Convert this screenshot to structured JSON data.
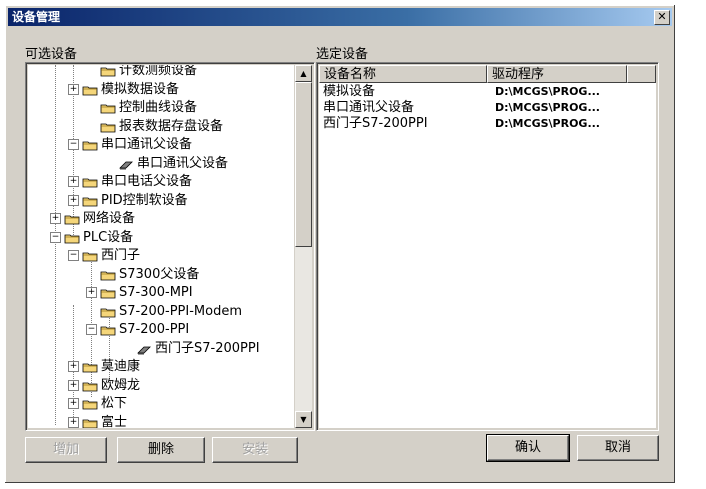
{
  "window": {
    "title": "设备管理",
    "close_glyph": "✕"
  },
  "left_group": {
    "label": "可选设备",
    "tree": [
      {
        "label": "计数测频设备",
        "expander": "",
        "kind": "folder"
      },
      {
        "label": "模拟数据设备",
        "expander": "+",
        "kind": "folder"
      },
      {
        "label": "控制曲线设备",
        "expander": "",
        "kind": "folder"
      },
      {
        "label": "报表数据存盘设备",
        "expander": "",
        "kind": "folder"
      },
      {
        "label": "串口通讯父设备",
        "expander": "−",
        "kind": "folder"
      },
      {
        "label": "串口通讯父设备",
        "expander": "",
        "kind": "device"
      },
      {
        "label": "串口电话父设备",
        "expander": "+",
        "kind": "folder"
      },
      {
        "label": "PID控制软设备",
        "expander": "+",
        "kind": "folder"
      },
      {
        "label": "网络设备",
        "expander": "+",
        "kind": "folder"
      },
      {
        "label": "PLC设备",
        "expander": "−",
        "kind": "folder"
      },
      {
        "label": "西门子",
        "expander": "−",
        "kind": "folder"
      },
      {
        "label": "S7300父设备",
        "expander": "",
        "kind": "folder"
      },
      {
        "label": "S7-300-MPI",
        "expander": "+",
        "kind": "folder"
      },
      {
        "label": "S7-200-PPI-Modem",
        "expander": "",
        "kind": "folder"
      },
      {
        "label": "S7-200-PPI",
        "expander": "−",
        "kind": "folder"
      },
      {
        "label": "西门子S7-200PPI",
        "expander": "",
        "kind": "device"
      },
      {
        "label": "莫迪康",
        "expander": "+",
        "kind": "folder"
      },
      {
        "label": "欧姆龙",
        "expander": "+",
        "kind": "folder"
      },
      {
        "label": "松下",
        "expander": "+",
        "kind": "folder"
      },
      {
        "label": "富士",
        "expander": "+",
        "kind": "folder"
      }
    ],
    "scroll": {
      "up_glyph": "▲",
      "down_glyph": "▼"
    }
  },
  "right_group": {
    "label": "选定设备",
    "columns": [
      "设备名称",
      "驱动程序"
    ],
    "rows": [
      {
        "name": "模拟设备",
        "driver": "D:\\MCGS\\PROG..."
      },
      {
        "name": "串口通讯父设备",
        "driver": "D:\\MCGS\\PROG..."
      },
      {
        "name": "西门子S7-200PPI",
        "driver": "D:\\MCGS\\PROG..."
      }
    ]
  },
  "buttons": {
    "add": "增加",
    "delete": "删除",
    "install": "安装",
    "ok": "确认",
    "cancel": "取消"
  },
  "colors": {
    "titlebar_start": "#0a246a",
    "titlebar_end": "#a6caf0",
    "face": "#d4d0c8",
    "folder": "#f5d67a"
  }
}
